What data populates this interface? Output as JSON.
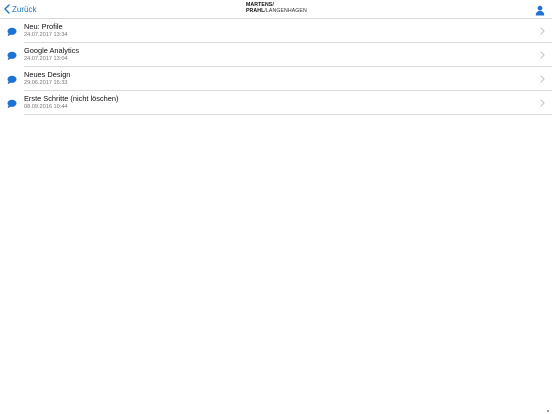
{
  "navbar": {
    "back_label": "Zurück",
    "logo_line1": "MARTENS/",
    "logo_line2_bold": "PRAHL",
    "logo_line2_rest": "LANGENHAGEN"
  },
  "colors": {
    "accent": "#1a73d9"
  },
  "messages": [
    {
      "title": "Neu: Profile",
      "date": "24.07.2017 13:34"
    },
    {
      "title": "Google Analytics",
      "date": "24.07.2017 13:04"
    },
    {
      "title": "Neues Design",
      "date": "29.06.2017 16:33"
    },
    {
      "title": "Erste Schritte (nicht löschen)",
      "date": "08.09.2016 10:44"
    }
  ]
}
